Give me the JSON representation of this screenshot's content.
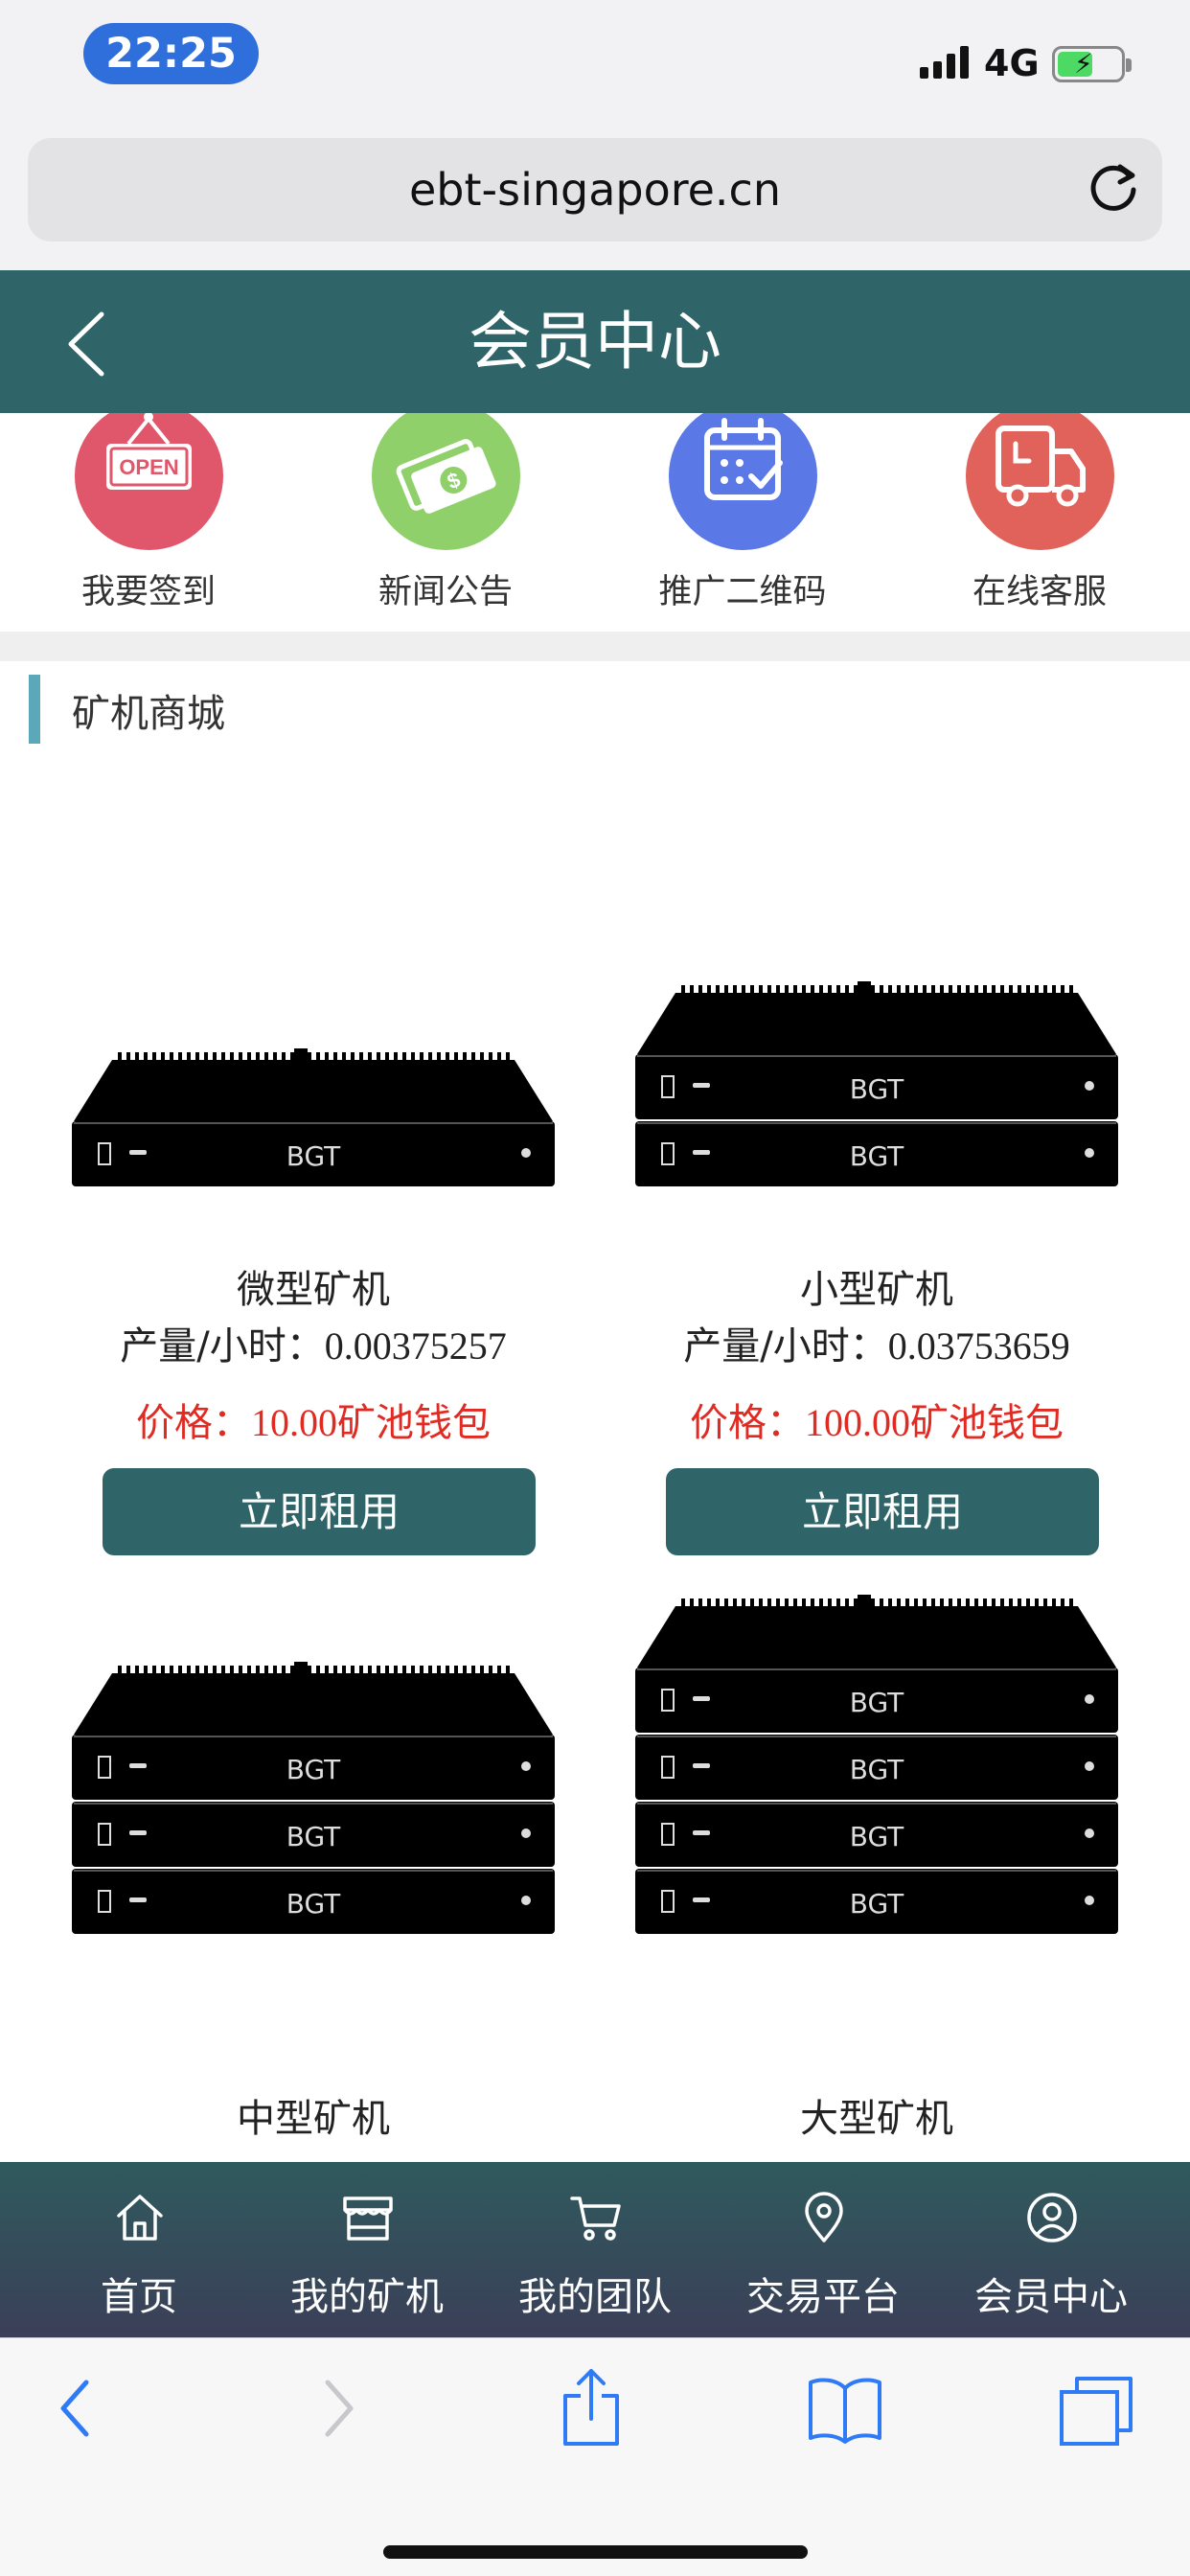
{
  "status_bar": {
    "time": "22:25",
    "network": "4G"
  },
  "browser": {
    "url": "ebt-singapore.cn"
  },
  "header": {
    "title": "会员中心"
  },
  "quick_menu": [
    {
      "label": "我要签到",
      "icon": "open-sign-icon",
      "color": "#e0566a"
    },
    {
      "label": "新闻公告",
      "icon": "money-icon",
      "color": "#8fd06b"
    },
    {
      "label": "推广二维码",
      "icon": "calendar-check-icon",
      "color": "#5a78e6"
    },
    {
      "label": "在线客服",
      "icon": "delivery-truck-icon",
      "color": "#e0625a"
    }
  ],
  "shop": {
    "title": "矿机商城",
    "rate_label": "产量/小时：",
    "price_label": "价格：",
    "price_unit": "矿池钱包",
    "products": [
      {
        "name": "微型矿机",
        "rate": "0.00375257",
        "price": "10.00",
        "button": "立即租用",
        "brand": "BGT",
        "units": 1
      },
      {
        "name": "小型矿机",
        "rate": "0.03753659",
        "price": "100.00",
        "button": "立即租用",
        "brand": "BGT",
        "units": 2
      },
      {
        "name": "中型矿机",
        "brand": "BGT",
        "units": 3
      },
      {
        "name": "大型矿机",
        "brand": "BGT",
        "units": 4
      }
    ]
  },
  "bottom_nav": [
    {
      "label": "首页",
      "icon": "home-icon"
    },
    {
      "label": "我的矿机",
      "icon": "store-icon"
    },
    {
      "label": "我的团队",
      "icon": "cart-icon"
    },
    {
      "label": "交易平台",
      "icon": "location-pin-icon"
    },
    {
      "label": "会员中心",
      "icon": "user-circle-icon"
    }
  ],
  "colors": {
    "header": "#2f6568",
    "price": "#e02a22",
    "accent_bar": "#5aa8b8",
    "time_pill": "#2f6fdc"
  }
}
